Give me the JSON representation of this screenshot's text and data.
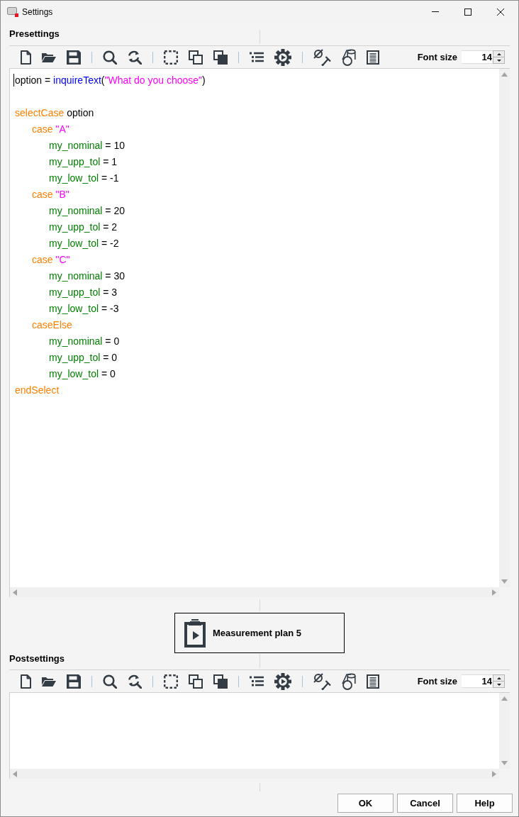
{
  "window": {
    "title": "Settings"
  },
  "presettings": {
    "title": "Presettings",
    "font_size_label": "Font size",
    "font_size": "14",
    "code": [
      {
        "kind": "code",
        "tokens": [
          {
            "text": "option = ",
            "kind": "plain"
          },
          {
            "text": "inquireText",
            "kind": "function"
          },
          {
            "text": "(",
            "kind": "plain"
          },
          {
            "text": "\"What do you choose\"",
            "kind": "string"
          },
          {
            "text": ")",
            "kind": "plain"
          }
        ]
      },
      {
        "kind": "blank"
      },
      {
        "kind": "code",
        "tokens": [
          {
            "text": "selectCase",
            "kind": "keyword"
          },
          {
            "text": " option",
            "kind": "plain"
          }
        ],
        "children": [
          {
            "kind": "code",
            "tokens": [
              {
                "text": "case ",
                "kind": "keyword"
              },
              {
                "text": "\"A\"",
                "kind": "string"
              }
            ],
            "children": [
              {
                "kind": "code",
                "tokens": [
                  {
                    "text": "my_nominal",
                    "kind": "variable"
                  },
                  {
                    "text": " = 10",
                    "kind": "plain"
                  }
                ]
              },
              {
                "kind": "code",
                "tokens": [
                  {
                    "text": "my_upp_tol",
                    "kind": "variable"
                  },
                  {
                    "text": " = 1",
                    "kind": "plain"
                  }
                ]
              },
              {
                "kind": "code",
                "tokens": [
                  {
                    "text": "my_low_tol",
                    "kind": "variable"
                  },
                  {
                    "text": " = -1",
                    "kind": "plain"
                  }
                ]
              }
            ]
          },
          {
            "kind": "code",
            "tokens": [
              {
                "text": "case ",
                "kind": "keyword"
              },
              {
                "text": "\"B\"",
                "kind": "string"
              }
            ],
            "children": [
              {
                "kind": "code",
                "tokens": [
                  {
                    "text": "my_nominal",
                    "kind": "variable"
                  },
                  {
                    "text": " = 20",
                    "kind": "plain"
                  }
                ]
              },
              {
                "kind": "code",
                "tokens": [
                  {
                    "text": "my_upp_tol",
                    "kind": "variable"
                  },
                  {
                    "text": " = 2",
                    "kind": "plain"
                  }
                ]
              },
              {
                "kind": "code",
                "tokens": [
                  {
                    "text": "my_low_tol",
                    "kind": "variable"
                  },
                  {
                    "text": " = -2",
                    "kind": "plain"
                  }
                ]
              }
            ]
          },
          {
            "kind": "code",
            "tokens": [
              {
                "text": "case ",
                "kind": "keyword"
              },
              {
                "text": "\"C\"",
                "kind": "string"
              }
            ],
            "children": [
              {
                "kind": "code",
                "tokens": [
                  {
                    "text": "my_nominal",
                    "kind": "variable"
                  },
                  {
                    "text": " = 30",
                    "kind": "plain"
                  }
                ]
              },
              {
                "kind": "code",
                "tokens": [
                  {
                    "text": "my_upp_tol",
                    "kind": "variable"
                  },
                  {
                    "text": " = 3",
                    "kind": "plain"
                  }
                ]
              },
              {
                "kind": "code",
                "tokens": [
                  {
                    "text": "my_low_tol",
                    "kind": "variable"
                  },
                  {
                    "text": " = -3",
                    "kind": "plain"
                  }
                ]
              }
            ]
          },
          {
            "kind": "code",
            "tokens": [
              {
                "text": "caseElse",
                "kind": "keyword"
              }
            ],
            "children": [
              {
                "kind": "code",
                "tokens": [
                  {
                    "text": "my_nominal",
                    "kind": "variable"
                  },
                  {
                    "text": " = 0",
                    "kind": "plain"
                  }
                ]
              },
              {
                "kind": "code",
                "tokens": [
                  {
                    "text": "my_upp_tol",
                    "kind": "variable"
                  },
                  {
                    "text": " = 0",
                    "kind": "plain"
                  }
                ]
              },
              {
                "kind": "code",
                "tokens": [
                  {
                    "text": "my_low_tol",
                    "kind": "variable"
                  },
                  {
                    "text": " = 0",
                    "kind": "plain"
                  }
                ]
              }
            ]
          }
        ]
      },
      {
        "kind": "code",
        "tokens": [
          {
            "text": "endSelect",
            "kind": "keyword"
          }
        ]
      }
    ]
  },
  "run_button": {
    "label": "Measurement plan 5"
  },
  "postsettings": {
    "title": "Postsettings",
    "font_size_label": "Font size",
    "font_size": "14"
  },
  "buttons": [
    {
      "label": "OK"
    },
    {
      "label": "Cancel"
    },
    {
      "label": "Help"
    }
  ]
}
